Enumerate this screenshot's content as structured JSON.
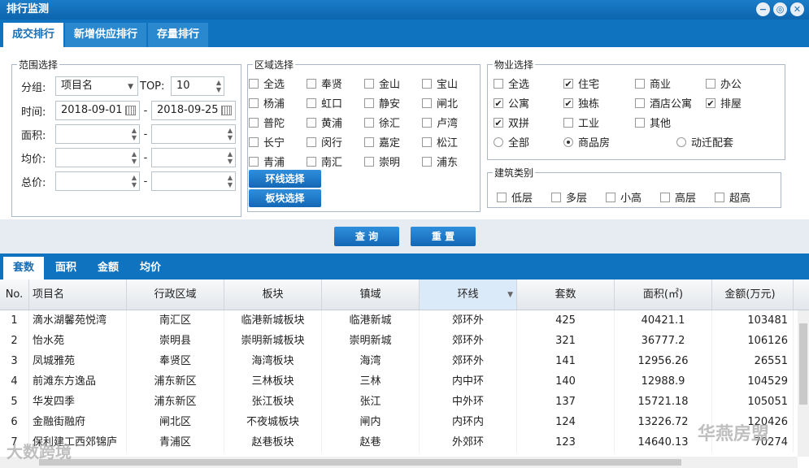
{
  "window": {
    "title": "排行监测"
  },
  "tabs": [
    "成交排行",
    "新增供应排行",
    "存量排行"
  ],
  "range": {
    "legend": "范围选择",
    "group_label": "分组:",
    "group_value": "项目名",
    "top_label": "TOP:",
    "top_value": "10",
    "time_label": "时间:",
    "date_from": "2018-09-01",
    "date_to": "2018-09-25",
    "area_label": "面积:",
    "price_label": "均价:",
    "total_label": "总价:",
    "dash": "-"
  },
  "region": {
    "legend": "区域选择",
    "items": [
      {
        "label": "全选",
        "checked": false
      },
      {
        "label": "奉贤",
        "checked": false
      },
      {
        "label": "金山",
        "checked": false
      },
      {
        "label": "宝山",
        "checked": false
      },
      {
        "label": "杨浦",
        "checked": false
      },
      {
        "label": "虹口",
        "checked": false
      },
      {
        "label": "静安",
        "checked": false
      },
      {
        "label": "闸北",
        "checked": false
      },
      {
        "label": "普陀",
        "checked": false
      },
      {
        "label": "黄浦",
        "checked": false
      },
      {
        "label": "徐汇",
        "checked": false
      },
      {
        "label": "卢湾",
        "checked": false
      },
      {
        "label": "长宁",
        "checked": false
      },
      {
        "label": "闵行",
        "checked": false
      },
      {
        "label": "嘉定",
        "checked": false
      },
      {
        "label": "松江",
        "checked": false
      },
      {
        "label": "青浦",
        "checked": false
      },
      {
        "label": "南汇",
        "checked": false
      },
      {
        "label": "崇明",
        "checked": false
      },
      {
        "label": "浦东",
        "checked": false
      }
    ],
    "ring_button": "环线选择",
    "block_button": "板块选择"
  },
  "property": {
    "legend": "物业选择",
    "items": [
      {
        "label": "全选",
        "checked": false
      },
      {
        "label": "住宅",
        "checked": true
      },
      {
        "label": "商业",
        "checked": false
      },
      {
        "label": "办公",
        "checked": false
      },
      {
        "label": "公寓",
        "checked": true
      },
      {
        "label": "独栋",
        "checked": true
      },
      {
        "label": "酒店公寓",
        "checked": false
      },
      {
        "label": "排屋",
        "checked": true
      },
      {
        "label": "双拼",
        "checked": true
      },
      {
        "label": "工业",
        "checked": false
      },
      {
        "label": "其他",
        "checked": false
      }
    ],
    "radios": [
      {
        "label": "全部",
        "selected": false
      },
      {
        "label": "商品房",
        "selected": true
      },
      {
        "label": "动迁配套",
        "selected": false
      }
    ]
  },
  "building": {
    "legend": "建筑类别",
    "items": [
      {
        "label": "低层",
        "checked": false
      },
      {
        "label": "多层",
        "checked": false
      },
      {
        "label": "小高",
        "checked": false
      },
      {
        "label": "高层",
        "checked": false
      },
      {
        "label": "超高",
        "checked": false
      }
    ]
  },
  "actions": {
    "query": "查 询",
    "reset": "重 置"
  },
  "subtabs": [
    "套数",
    "面积",
    "金额",
    "均价"
  ],
  "table": {
    "headers": [
      "No.",
      "项目名",
      "行政区域",
      "板块",
      "镇域",
      "环线",
      "套数",
      "面积(㎡)",
      "金额(万元)"
    ],
    "rows": [
      [
        "1",
        "滴水湖馨苑悦湾",
        "南汇区",
        "临港新城板块",
        "临港新城",
        "郊环外",
        "425",
        "40421.1",
        "103481"
      ],
      [
        "2",
        "怡水苑",
        "崇明县",
        "崇明新城板块",
        "崇明新城",
        "郊环外",
        "321",
        "36777.2",
        "106126"
      ],
      [
        "3",
        "凤城雅苑",
        "奉贤区",
        "海湾板块",
        "海湾",
        "郊环外",
        "141",
        "12956.26",
        "26551"
      ],
      [
        "4",
        "前滩东方逸品",
        "浦东新区",
        "三林板块",
        "三林",
        "内中环",
        "140",
        "12988.9",
        "104529"
      ],
      [
        "5",
        "华发四季",
        "浦东新区",
        "张江板块",
        "张江",
        "中外环",
        "137",
        "15721.18",
        "105051"
      ],
      [
        "6",
        "金融街融府",
        "闸北区",
        "不夜城板块",
        "闸内",
        "内环内",
        "124",
        "13226.72",
        "120426"
      ],
      [
        "7",
        "保利建工西郊锦庐",
        "青浦区",
        "赵巷板块",
        "赵巷",
        "外郊环",
        "123",
        "14640.13",
        "70274"
      ]
    ]
  },
  "watermarks": {
    "left": "大数跨境",
    "right": "华燕房盟"
  }
}
